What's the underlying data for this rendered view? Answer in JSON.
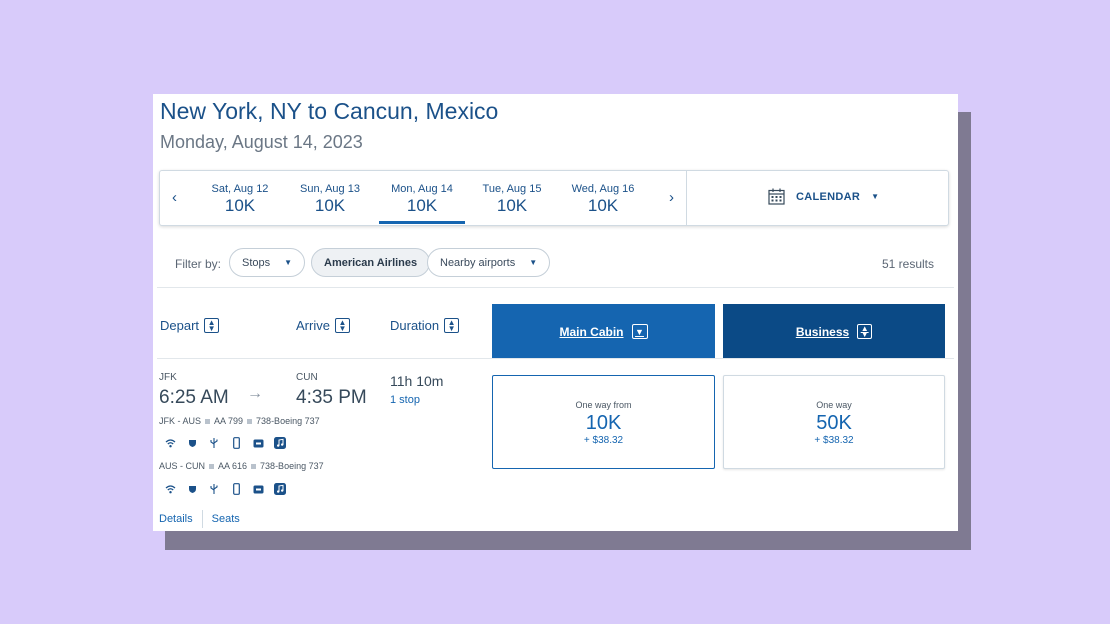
{
  "header": {
    "title": "New York, NY to Cancun, Mexico",
    "subtitle": "Monday, August 14, 2023"
  },
  "date_nav": {
    "prev_icon": "chevron-left-icon",
    "next_icon": "chevron-right-icon",
    "prev_glyph": "‹",
    "next_glyph": "›",
    "dates": [
      {
        "label": "Sat, Aug 12",
        "value": "10K",
        "active": false
      },
      {
        "label": "Sun, Aug 13",
        "value": "10K",
        "active": false
      },
      {
        "label": "Mon, Aug 14",
        "value": "10K",
        "active": true
      },
      {
        "label": "Tue, Aug 15",
        "value": "10K",
        "active": false
      },
      {
        "label": "Wed, Aug 16",
        "value": "10K",
        "active": false
      }
    ],
    "calendar_label": "CALENDAR",
    "calendar_caret": "▼"
  },
  "filters": {
    "label": "Filter by:",
    "stops": "Stops",
    "airline": "American Airlines",
    "nearby": "Nearby airports",
    "caret": "▼",
    "results": "51 results"
  },
  "columns": {
    "depart": "Depart",
    "arrive": "Arrive",
    "duration": "Duration",
    "main_cabin": "Main Cabin",
    "business": "Business"
  },
  "flight": {
    "depart_code": "JFK",
    "depart_time": "6:25 AM",
    "arrow": "→",
    "arrive_code": "CUN",
    "arrive_time": "4:35 PM",
    "duration": "11h 10m",
    "stops": "1 stop",
    "segments": [
      {
        "route": "JFK - AUS",
        "flight": "AA 799",
        "aircraft": "738-Boeing 737"
      },
      {
        "route": "AUS - CUN",
        "flight": "AA 616",
        "aircraft": "738-Boeing 737"
      }
    ],
    "amenity_icons": [
      "wifi-icon",
      "power-icon",
      "usb-icon",
      "phone-icon",
      "tv-icon",
      "music-icon"
    ],
    "details_link": "Details",
    "seats_link": "Seats"
  },
  "fares": {
    "main": {
      "label": "One way from",
      "price": "10K",
      "tax": "+ $38.32"
    },
    "business": {
      "label": "One way",
      "price": "50K",
      "tax": "+ $38.32"
    }
  },
  "colors": {
    "background": "#d8cbfa",
    "brand_blue": "#1565b0",
    "business_blue": "#0b4a86",
    "title_blue": "#1b5189"
  }
}
